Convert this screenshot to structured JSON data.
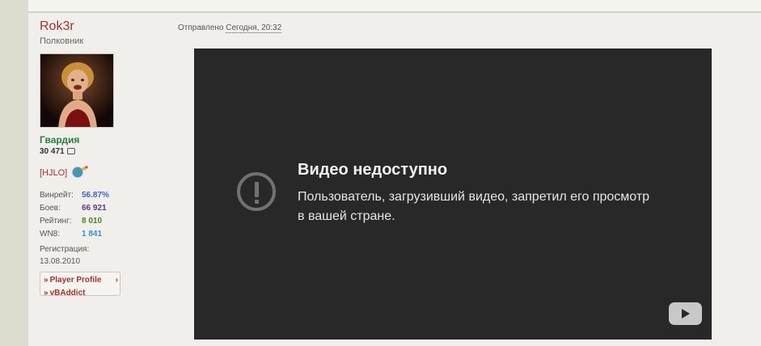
{
  "user": {
    "username": "Rok3r",
    "rank": "Полковник",
    "clan_name": "Гвардия",
    "post_count": "30 471",
    "clan_tag": "[HJLO]"
  },
  "stats": [
    {
      "label": "Винрейт:",
      "value": "56.87%",
      "color": "#3a67c8"
    },
    {
      "label": "Боев:",
      "value": "66 921",
      "color": "#5b3b8c"
    },
    {
      "label": "Рейтинг:",
      "value": "8 010",
      "color": "#4e7d2a"
    },
    {
      "label": "WN8:",
      "value": "1 841",
      "color": "#3a8fc8"
    }
  ],
  "registration": {
    "label": "Регистрация:",
    "date": "13.08.2010"
  },
  "links": {
    "player_profile": "Player Profile",
    "second": "vBAddict"
  },
  "post": {
    "sent_label": "Отправлено",
    "sent_time": "Сегодня, 20:32"
  },
  "video": {
    "title": "Видео недоступно",
    "message": "Пользователь, загрузивший видео, запретил его просмотр в вашей стране.",
    "icon": "warning-circle-icon",
    "logo": "youtube-icon"
  },
  "colors": {
    "username": "#a4332b",
    "clan": "#2e7d3b",
    "video_bg": "#282828"
  }
}
